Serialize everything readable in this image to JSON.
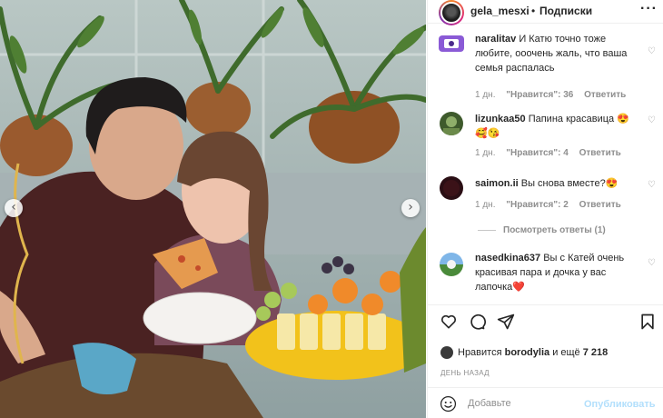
{
  "post": {
    "author": "gela_mesxi",
    "follow_label": "Подписки",
    "separator": "•",
    "more_label": "···"
  },
  "comments": [
    {
      "username": "naralitav",
      "text": "И Катю точно тоже любите, ооочень жаль, что ваша семья распалась",
      "time": "1 дн.",
      "likes": "\"Нравится\": 36",
      "reply": "Ответить"
    },
    {
      "username": "lizunkaa50",
      "text": "Папина красавица 😍🥰😘",
      "time": "1 дн.",
      "likes": "\"Нравится\": 4",
      "reply": "Ответить"
    },
    {
      "username": "saimon.ii",
      "text": "Вы снова вместе?😍",
      "time": "1 дн.",
      "likes": "\"Нравится\": 2",
      "reply": "Ответить"
    },
    {
      "username": "nasedkina637",
      "text": "Вы с Катей очень красивая пара и дочка у вас лапочка❤️",
      "time": "",
      "likes": "",
      "reply": ""
    }
  ],
  "view_replies": "Посмотреть ответы (1)",
  "likes_line": {
    "prefix": "Нравится",
    "user": "borodylia",
    "suffix": "и ещё",
    "count": "7 218"
  },
  "date": "ДЕНЬ НАЗАД",
  "add_comment": {
    "placeholder": "Добавьте",
    "publish": "Опубликовать"
  },
  "colors": {
    "link_blue": "#b2dffc",
    "muted": "#8e8e8e",
    "text": "#262626"
  },
  "icons": [
    "more-icon",
    "heart-icon",
    "comment-icon",
    "share-icon",
    "bookmark-icon",
    "emoji-icon",
    "prev-arrow-icon",
    "next-arrow-icon"
  ]
}
